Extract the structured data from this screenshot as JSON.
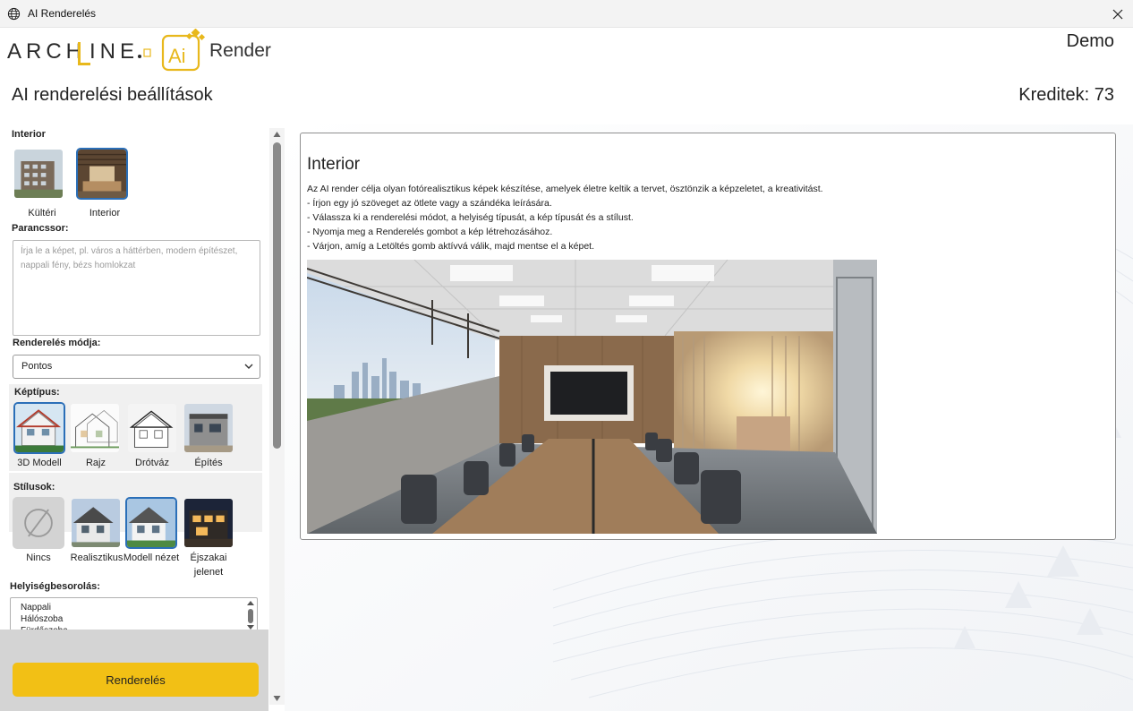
{
  "window": {
    "title": "AI Renderelés"
  },
  "header": {
    "brand_archline": "ARCH",
    "brand_archline_rest": "INE",
    "brand_render": "Render",
    "brand_ai": "Ai",
    "user": "Demo",
    "page_title": "AI renderelési beállítások",
    "credits": "Kreditek: 73"
  },
  "sidebar": {
    "scene_label": "Interior",
    "scenes": [
      {
        "label": "Kültéri",
        "selected": false
      },
      {
        "label": "Interior",
        "selected": true
      }
    ],
    "prompt_label": "Parancssor:",
    "prompt_placeholder": "Írja le a képet, pl. város a háttérben, modern építészet, nappali fény, bézs homlokzat",
    "prompt_value": "",
    "mode_label": "Renderelés módja:",
    "mode_value": "Pontos",
    "image_type_label": "Képtípus:",
    "image_types": [
      {
        "label": "3D Modell",
        "selected": true
      },
      {
        "label": "Rajz",
        "selected": false
      },
      {
        "label": "Drótváz",
        "selected": false
      },
      {
        "label": "Építés",
        "selected": false
      }
    ],
    "styles_label": "Stílusok:",
    "styles": [
      {
        "label": "Nincs",
        "selected": false
      },
      {
        "label": "Realisztikus",
        "selected": false
      },
      {
        "label": "Modell nézet",
        "selected": true
      },
      {
        "label": "Éjszakai jelenet",
        "selected": false
      }
    ],
    "room_label": "Helyiségbesorolás:",
    "rooms": [
      "Nappali",
      "Hálószoba",
      "Fürdőszoba"
    ],
    "render_button": "Renderelés"
  },
  "main": {
    "title": "Interior",
    "lines": [
      "Az AI render célja olyan fotórealisztikus képek készítése, amelyek életre keltik a tervet, ösztönzik a képzeletet, a kreativitást.",
      "- Írjon egy jó szöveget az ötlete vagy a szándéka leírására.",
      "- Válassza ki a renderelési módot, a helyiség típusát, a kép típusát és a stílust.",
      "- Nyomja meg a Renderelés gombot a kép létrehozásához.",
      "- Várjon, amíg a Letöltés gomb aktívvá válik, majd mentse el a képet."
    ]
  },
  "colors": {
    "accent": "#f2c015",
    "selection": "#2b6fb8",
    "logo_gold": "#e8b81c",
    "text": "#222222"
  },
  "icons": {
    "window": "globe-icon",
    "close": "close-icon",
    "select": "chevron-down-icon",
    "none_style": "no-style-icon"
  }
}
